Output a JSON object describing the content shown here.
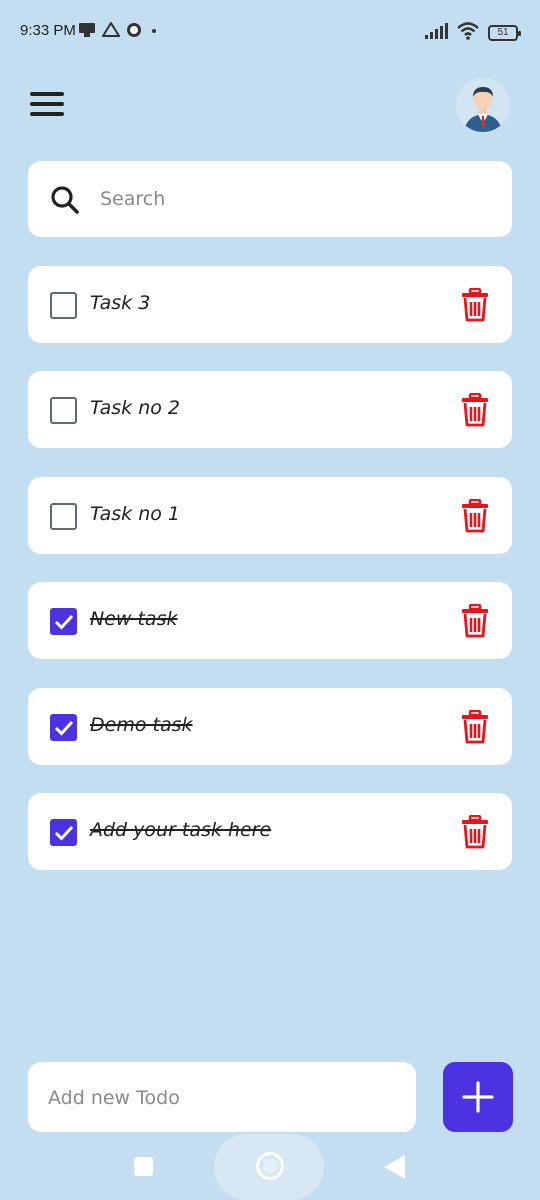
{
  "status_bar": {
    "time": "9:33 PM",
    "battery": "51",
    "left_icons": [
      "notification-icon",
      "drive-icon",
      "whatsapp-icon",
      "dot-icon"
    ],
    "right_icons": [
      "signal-icon",
      "wifi-icon",
      "battery-icon"
    ]
  },
  "header": {
    "menu_icon": "hamburger-menu-icon",
    "avatar_icon": "user-avatar"
  },
  "search": {
    "placeholder": "Search",
    "value": ""
  },
  "todos": [
    {
      "label": "Task 3",
      "checked": false
    },
    {
      "label": "Task no 2",
      "checked": false
    },
    {
      "label": "Task no 1",
      "checked": false
    },
    {
      "label": "New task",
      "checked": true
    },
    {
      "label": "Demo task",
      "checked": true
    },
    {
      "label": "Add your task here",
      "checked": true
    }
  ],
  "new_todo": {
    "placeholder": "Add new Todo",
    "value": ""
  },
  "colors": {
    "background": "#c3def0",
    "accent": "#4b33e2",
    "delete": "#e8141c",
    "card": "#ffffff"
  }
}
